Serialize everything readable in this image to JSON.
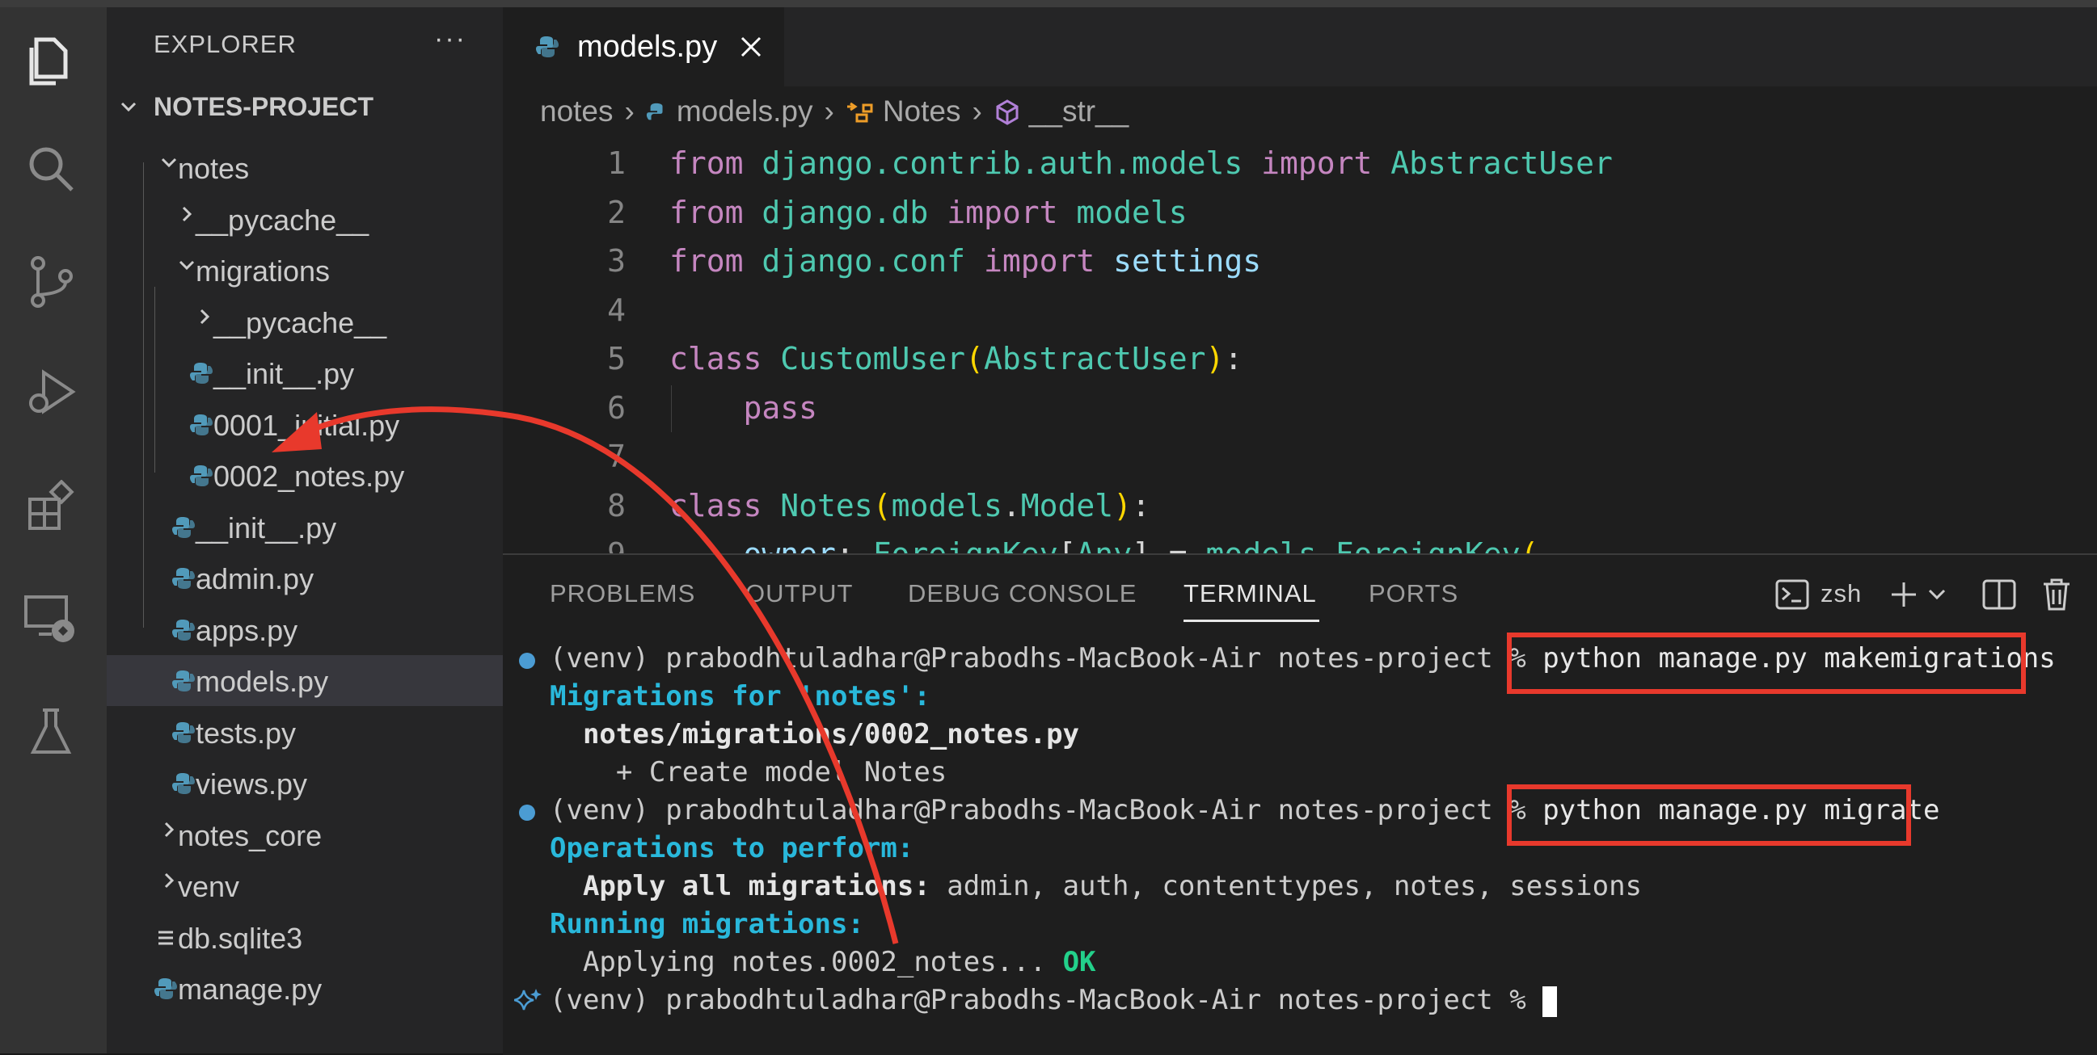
{
  "activity_bar": {
    "icons": [
      "explorer-icon",
      "search-icon",
      "source-control-icon",
      "run-debug-icon",
      "extensions-icon",
      "remote-explorer-icon",
      "testing-icon"
    ]
  },
  "sidebar": {
    "title": "EXPLORER",
    "more": "···",
    "root": "NOTES-PROJECT",
    "items": [
      {
        "label": "notes",
        "type": "folder-open",
        "depth": 0
      },
      {
        "label": "__pycache__",
        "type": "folder",
        "depth": 1
      },
      {
        "label": "migrations",
        "type": "folder-open",
        "depth": 1
      },
      {
        "label": "__pycache__",
        "type": "folder",
        "depth": 2
      },
      {
        "label": "__init__.py",
        "type": "py",
        "depth": 2
      },
      {
        "label": "0001_initial.py",
        "type": "py",
        "depth": 2
      },
      {
        "label": "0002_notes.py",
        "type": "py",
        "depth": 2
      },
      {
        "label": "__init__.py",
        "type": "py",
        "depth": 1
      },
      {
        "label": "admin.py",
        "type": "py",
        "depth": 1
      },
      {
        "label": "apps.py",
        "type": "py",
        "depth": 1
      },
      {
        "label": "models.py",
        "type": "py",
        "depth": 1,
        "selected": true
      },
      {
        "label": "tests.py",
        "type": "py",
        "depth": 1
      },
      {
        "label": "views.py",
        "type": "py",
        "depth": 1
      },
      {
        "label": "notes_core",
        "type": "folder",
        "depth": 0
      },
      {
        "label": "venv",
        "type": "folder",
        "depth": 0
      },
      {
        "label": "db.sqlite3",
        "type": "db",
        "depth": 0
      },
      {
        "label": "manage.py",
        "type": "py",
        "depth": 0
      }
    ]
  },
  "editor": {
    "tab_label": "models.py",
    "breadcrumb": [
      "notes",
      "models.py",
      "Notes",
      "__str__"
    ],
    "lines": [
      {
        "n": "1",
        "segments": [
          [
            "kw",
            "from"
          ],
          [
            "op",
            " "
          ],
          [
            "mod",
            "django.contrib.auth.models"
          ],
          [
            "op",
            " "
          ],
          [
            "kw",
            "import"
          ],
          [
            "op",
            " "
          ],
          [
            "cls",
            "AbstractUser"
          ]
        ]
      },
      {
        "n": "2",
        "segments": [
          [
            "kw",
            "from"
          ],
          [
            "op",
            " "
          ],
          [
            "mod",
            "django.db"
          ],
          [
            "op",
            " "
          ],
          [
            "kw",
            "import"
          ],
          [
            "op",
            " "
          ],
          [
            "mod",
            "models"
          ]
        ]
      },
      {
        "n": "3",
        "segments": [
          [
            "kw",
            "from"
          ],
          [
            "op",
            " "
          ],
          [
            "mod",
            "django.conf"
          ],
          [
            "op",
            " "
          ],
          [
            "kw",
            "import"
          ],
          [
            "op",
            " "
          ],
          [
            "var",
            "settings"
          ]
        ]
      },
      {
        "n": "4",
        "segments": []
      },
      {
        "n": "5",
        "segments": [
          [
            "kw",
            "class"
          ],
          [
            "op",
            " "
          ],
          [
            "cls",
            "CustomUser"
          ],
          [
            "paren",
            "("
          ],
          [
            "cls",
            "AbstractUser"
          ],
          [
            "paren",
            ")"
          ],
          [
            "op",
            ":"
          ]
        ]
      },
      {
        "n": "6",
        "segments": [
          [
            "op",
            "    "
          ],
          [
            "kw",
            "pass"
          ]
        ]
      },
      {
        "n": "7",
        "segments": []
      },
      {
        "n": "8",
        "segments": [
          [
            "kw",
            "class"
          ],
          [
            "op",
            " "
          ],
          [
            "cls",
            "Notes"
          ],
          [
            "paren",
            "("
          ],
          [
            "mod",
            "models"
          ],
          [
            "op",
            "."
          ],
          [
            "cls",
            "Model"
          ],
          [
            "paren",
            ")"
          ],
          [
            "op",
            ":"
          ]
        ]
      },
      {
        "n": "9",
        "segments": [
          [
            "op",
            "    "
          ],
          [
            "var",
            "owner"
          ],
          [
            "op",
            ": "
          ],
          [
            "cls",
            "ForeignKey"
          ],
          [
            "op",
            "["
          ],
          [
            "cls",
            "Any"
          ],
          [
            "op",
            "] = "
          ],
          [
            "mod",
            "models"
          ],
          [
            "op",
            "."
          ],
          [
            "cls",
            "ForeignKey"
          ],
          [
            "paren",
            "("
          ]
        ]
      }
    ]
  },
  "panel": {
    "tabs": [
      "PROBLEMS",
      "OUTPUT",
      "DEBUG CONSOLE",
      "TERMINAL",
      "PORTS"
    ],
    "active_tab": "TERMINAL",
    "shell_label": "zsh",
    "terminal": [
      {
        "prompt": "(venv) prabodhtuladhar@Prabodhs-MacBook-Air notes-project % ",
        "cmd": "python manage.py makemigrations",
        "dot": true
      },
      {
        "text": "Migrations for 'notes':",
        "style": "cyan-bold"
      },
      {
        "text": "  notes/migrations/0002_notes.py",
        "style": "bold"
      },
      {
        "text": "    + Create model Notes",
        "style": "plain"
      },
      {
        "prompt": "(venv) prabodhtuladhar@Prabodhs-MacBook-Air notes-project % ",
        "cmd": "python manage.py migrate",
        "dot": true
      },
      {
        "text": "Operations to perform:",
        "style": "cyan-bold"
      },
      {
        "bold": "  Apply all migrations:",
        "rest": " admin, auth, contenttypes, notes, sessions"
      },
      {
        "text": "Running migrations:",
        "style": "cyan-bold"
      },
      {
        "plain": "  Applying notes.0002_notes...",
        "ok": " OK"
      },
      {
        "prompt": "(venv) prabodhtuladhar@Prabodhs-MacBook-Air notes-project % ",
        "cursor": true,
        "sparkle": true
      }
    ]
  },
  "colors": {
    "annotation": "#e8392c",
    "accent": "#4b9cd3"
  }
}
